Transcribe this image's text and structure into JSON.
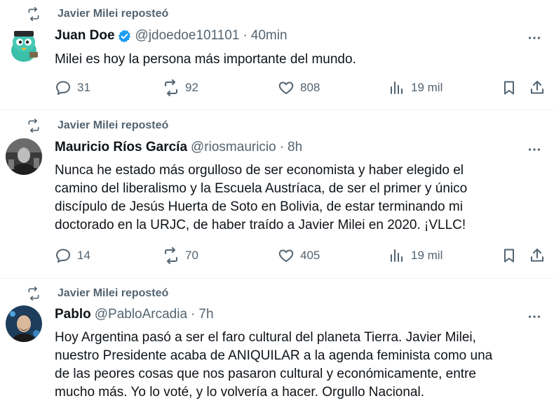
{
  "colors": {
    "text": "#0f1419",
    "secondary": "#536471",
    "verified": "#1d9bf0",
    "divider": "#eff3f4"
  },
  "tweets": [
    {
      "repost_label": "Javier Milei reposteó",
      "name": "Juan Doe",
      "verified": true,
      "handle": "@jdoedoe101101",
      "separator": "·",
      "time": "40min",
      "text": "Milei es hoy la persona más importante del mundo.",
      "replies": "31",
      "reposts": "92",
      "likes": "808",
      "views": "19 mil"
    },
    {
      "repost_label": "Javier Milei reposteó",
      "name": "Mauricio Ríos García",
      "verified": false,
      "handle": "@riosmauricio",
      "separator": "·",
      "time": "8h",
      "text_lines": [
        "Nunca he estado más orgulloso de ser economista y haber elegido el",
        "camino del liberalismo y la Escuela Austríaca, de ser el primer y único",
        "discípulo de Jesús Huerta de Soto en Bolivia, de estar terminando mi",
        "doctorado en la URJC, de haber traído a Javier Milei en 2020. ¡VLLC!"
      ],
      "replies": "14",
      "reposts": "70",
      "likes": "405",
      "views": "19 mil"
    },
    {
      "repost_label": "Javier Milei reposteó",
      "name": "Pablo",
      "verified": false,
      "handle": "@PabloArcadia",
      "separator": "·",
      "time": "7h",
      "text_lines": [
        "Hoy Argentina pasó a ser el faro cultural del planeta Tierra. Javier Milei,",
        "nuestro Presidente acaba de ANIQUILAR a la agenda feminista como una",
        "de las peores cosas que nos pasaron cultural y económicamente, entre",
        "mucho más. Yo lo voté, y lo volvería a hacer. Orgullo Nacional."
      ]
    }
  ]
}
